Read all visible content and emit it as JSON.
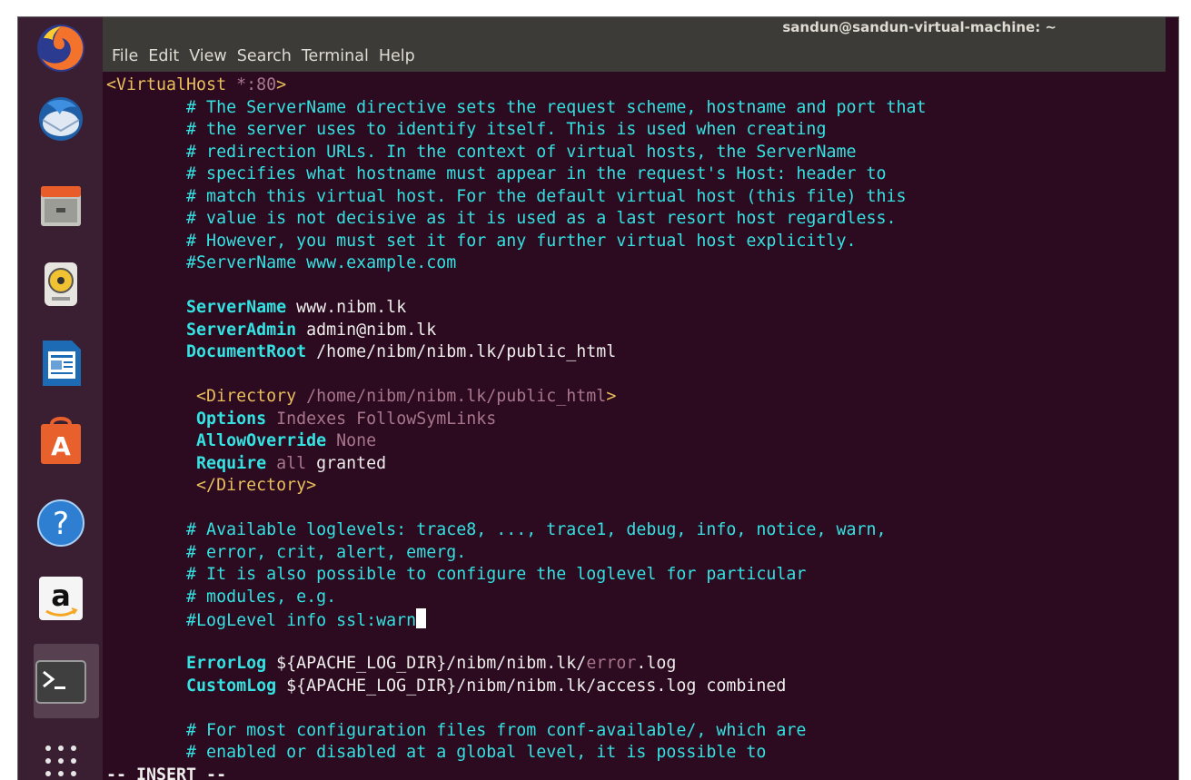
{
  "window": {
    "title": "sandun@sandun-virtual-machine: ~"
  },
  "menu": [
    "File",
    "Edit",
    "View",
    "Search",
    "Terminal",
    "Help"
  ],
  "dock": [
    {
      "name": "firefox-icon"
    },
    {
      "name": "thunderbird-icon"
    },
    {
      "name": "files-icon"
    },
    {
      "name": "rhythmbox-icon"
    },
    {
      "name": "writer-icon"
    },
    {
      "name": "software-center-icon"
    },
    {
      "name": "help-icon"
    },
    {
      "name": "amazon-icon"
    },
    {
      "name": "terminal-icon"
    },
    {
      "name": "app-grid-icon"
    }
  ],
  "colors": {
    "background": "#2c0a1f",
    "comment": "#34e2e2",
    "tag": "#e9bf5d",
    "value": "#a8778e"
  },
  "editor": {
    "l1a": "<VirtualHost",
    "l1b": " *:80",
    "l1c": ">",
    "c1": "        # The ServerName directive sets the request scheme, hostname and port that",
    "c2": "        # the server uses to identify itself. This is used when creating",
    "c3": "        # redirection URLs. In the context of virtual hosts, the ServerName",
    "c4": "        # specifies what hostname must appear in the request's Host: header to",
    "c5": "        # match this virtual host. For the default virtual host (this file) this",
    "c6": "        # value is not decisive as it is used as a last resort host regardless.",
    "c7": "        # However, you must set it for any further virtual host explicitly.",
    "c8": "        #ServerName www.example.com",
    "sn_key": "        ServerName",
    "sn_val": " www.nibm.lk",
    "sa_key": "        ServerAdmin",
    "sa_val": " admin@nibm.lk",
    "dr_key": "        DocumentRoot",
    "dr_val": " /home/nibm/nibm.lk/public_html",
    "dir_open_a": "         <Directory",
    "dir_open_b": " /home/nibm/nibm.lk/public_html",
    "dir_open_c": ">",
    "opt_key": "         Options",
    "opt_val": " Indexes FollowSymLinks",
    "ao_key": "         AllowOverride",
    "ao_val": " None",
    "req_key": "         Require",
    "req_val1": " all",
    "req_val2": " granted",
    "dir_close": "         </Directory>",
    "c9": "        # Available loglevels: trace8, ..., trace1, debug, info, notice, warn,",
    "c10": "        # error, crit, alert, emerg.",
    "c11": "        # It is also possible to configure the loglevel for particular",
    "c12": "        # modules, e.g.",
    "c13": "        #LogLevel info ssl:warn",
    "el_key": "        ErrorLog",
    "el_val1": " ${APACHE_LOG_DIR}/nibm/nibm.lk/",
    "el_val2": "error",
    "el_val3": ".log",
    "cl_key": "        CustomLog",
    "cl_val": " ${APACHE_LOG_DIR}/nibm/nibm.lk/access.log combined",
    "c14": "        # For most configuration files from conf-available/, which are",
    "c15": "        # enabled or disabled at a global level, it is possible to",
    "mode": "-- INSERT --"
  }
}
